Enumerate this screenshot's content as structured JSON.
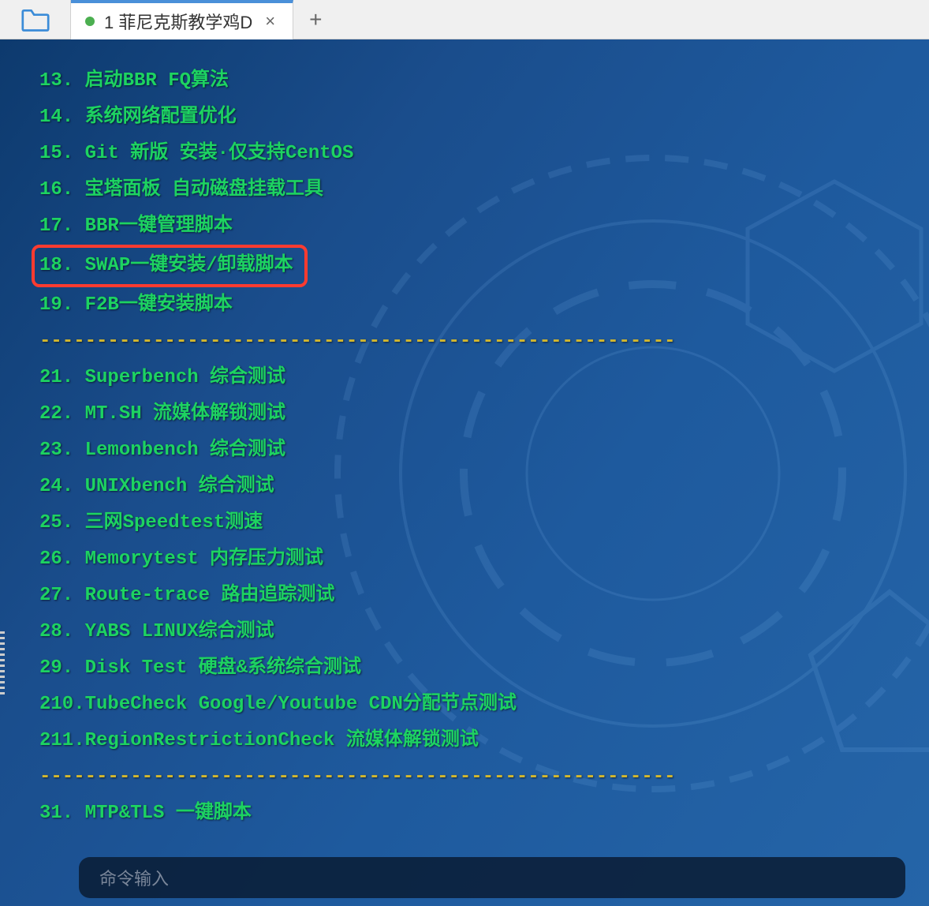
{
  "tab": {
    "label": "1 菲尼克斯教学鸡D",
    "close_glyph": "×",
    "add_glyph": "+"
  },
  "lines": [
    {
      "text": "13. 启动BBR FQ算法",
      "cls": "green"
    },
    {
      "text": "14. 系统网络配置优化",
      "cls": "green"
    },
    {
      "text": "15. Git 新版 安装·仅支持CentOS",
      "cls": "green"
    },
    {
      "text": "16. 宝塔面板 自动磁盘挂载工具",
      "cls": "green"
    },
    {
      "text": "17. BBR一键管理脚本",
      "cls": "green"
    },
    {
      "text": "18. SWAP一键安装/卸载脚本",
      "cls": "green",
      "highlight": true
    },
    {
      "text": "19. F2B一键安装脚本",
      "cls": "green"
    },
    {
      "text": "--------------------------------------------------------",
      "cls": "yellow"
    },
    {
      "text": "21. Superbench 综合测试",
      "cls": "green"
    },
    {
      "text": "22. MT.SH 流媒体解锁测试",
      "cls": "green"
    },
    {
      "text": "23. Lemonbench 综合测试",
      "cls": "green"
    },
    {
      "text": "24. UNIXbench 综合测试",
      "cls": "green"
    },
    {
      "text": "25. 三网Speedtest测速",
      "cls": "green"
    },
    {
      "text": "26. Memorytest 内存压力测试",
      "cls": "green"
    },
    {
      "text": "27. Route-trace 路由追踪测试",
      "cls": "green"
    },
    {
      "text": "28. YABS LINUX综合测试",
      "cls": "green"
    },
    {
      "text": "29. Disk Test 硬盘&系统综合测试",
      "cls": "green"
    },
    {
      "text": "210.TubeCheck Google/Youtube CDN分配节点测试",
      "cls": "green"
    },
    {
      "text": "211.RegionRestrictionCheck 流媒体解锁测试",
      "cls": "green"
    },
    {
      "text": "--------------------------------------------------------",
      "cls": "yellow"
    },
    {
      "text": "31. MTP&TLS 一键脚本",
      "cls": "green"
    }
  ],
  "input": {
    "placeholder": "命令输入"
  }
}
